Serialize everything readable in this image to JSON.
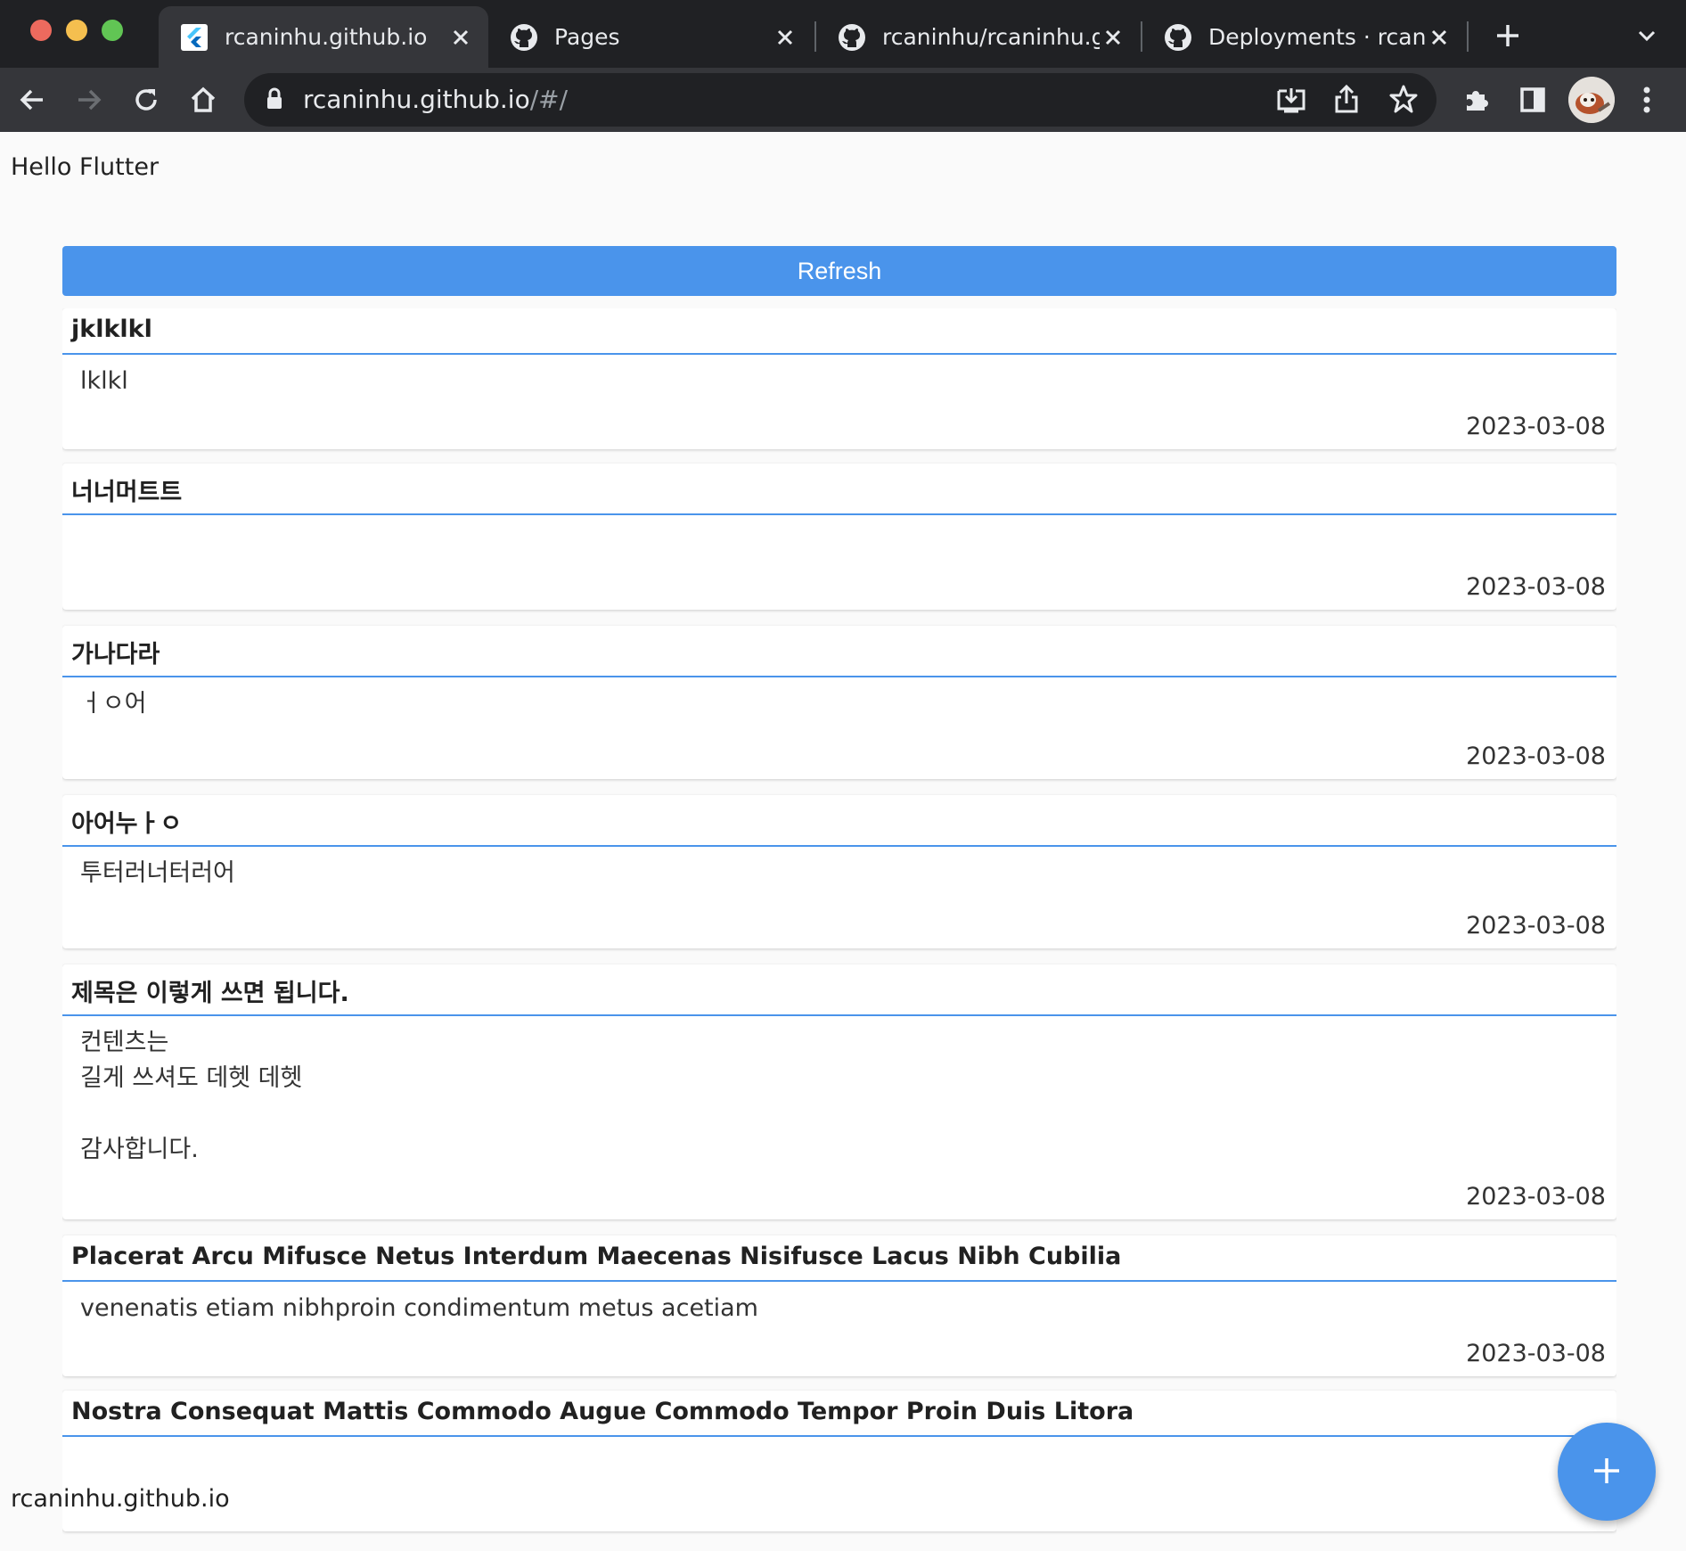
{
  "browser": {
    "tabs": [
      {
        "title": "rcaninhu.github.io",
        "icon": "flutter-icon",
        "active": true
      },
      {
        "title": "Pages",
        "icon": "github-icon",
        "active": false
      },
      {
        "title": "rcaninhu/rcaninhu.git",
        "icon": "github-icon",
        "active": false
      },
      {
        "title": "Deployments · rcanin",
        "icon": "github-icon",
        "active": false
      }
    ],
    "url_host": "rcaninhu.github.io",
    "url_path": "/#/"
  },
  "app": {
    "title": "Hello Flutter",
    "refresh_label": "Refresh",
    "status_text": "rcaninhu.github.io",
    "accent_color": "#4a94eb"
  },
  "posts": [
    {
      "title": "jklklkl",
      "content": "lklkl",
      "date": "2023-03-08"
    },
    {
      "title": "너너머트트",
      "content": "",
      "date": "2023-03-08"
    },
    {
      "title": "가나다라",
      "content": "ㅓㅇ어",
      "date": "2023-03-08"
    },
    {
      "title": "아어누ㅏㅇ",
      "content": "투터러너터러어",
      "date": "2023-03-08"
    },
    {
      "title": "제목은 이렇게 쓰면 됩니다.",
      "content": "컨텐츠는\n길게 쓰셔도 데헷 데헷\n\n감사합니다.",
      "date": "2023-03-08"
    },
    {
      "title": "Placerat Arcu Mifusce Netus Interdum Maecenas Nisifusce Lacus Nibh Cubilia",
      "content": "venenatis etiam nibhproin condimentum metus acetiam",
      "date": "2023-03-08"
    },
    {
      "title": "Nostra Consequat Mattis Commodo Augue Commodo Tempor Proin Duis Litora",
      "content": "",
      "date": ""
    }
  ]
}
